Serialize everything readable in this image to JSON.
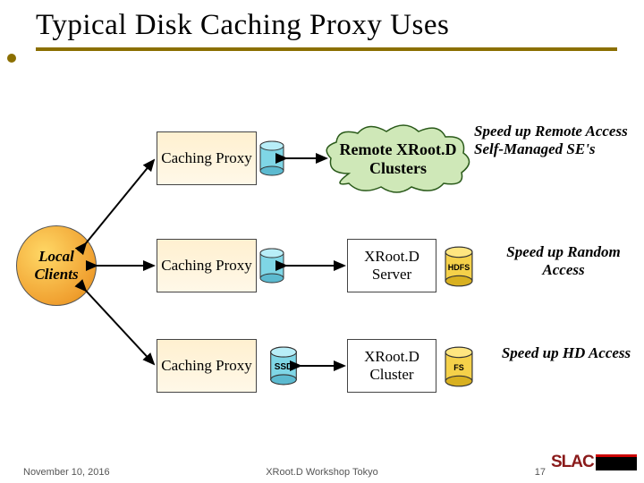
{
  "title": "Typical Disk Caching Proxy Uses",
  "local_clients": "Local Clients",
  "proxies": {
    "p1": "Caching Proxy",
    "p2": "Caching Proxy",
    "p3": "Caching Proxy"
  },
  "ssd_label": "SSD",
  "targets": {
    "remote_clusters": "Remote XRoot.D Clusters",
    "xrootd_server": "XRoot.D Server",
    "xrootd_cluster": "XRoot.D Cluster"
  },
  "disks": {
    "hdfs": "HDFS",
    "fs": "FS"
  },
  "annotations": {
    "a1": "Speed up Remote Access Self-Managed SE's",
    "a2": "Speed up Random Access",
    "a3": "Speed up HD Access"
  },
  "footer": {
    "date": "November 10, 2016",
    "center": "XRoot.D Workshop Tokyo",
    "page": "17",
    "logo": "SLAC"
  }
}
